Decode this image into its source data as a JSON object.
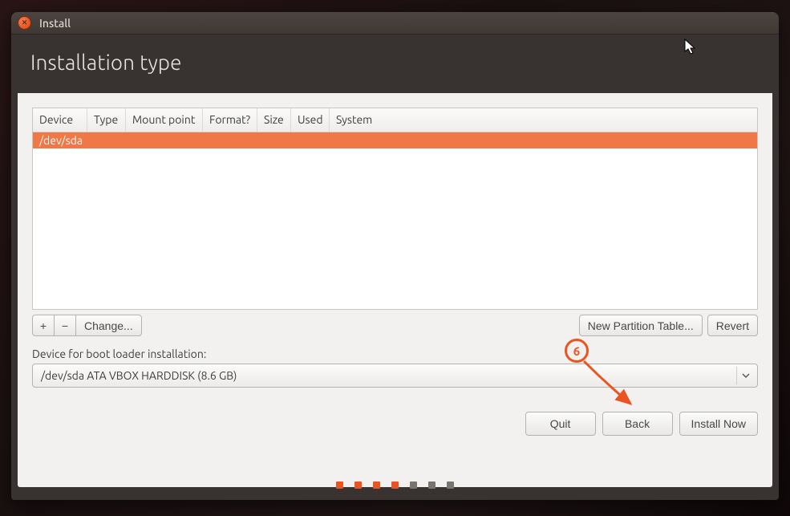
{
  "titlebar": {
    "title": "Install"
  },
  "header": {
    "page_title": "Installation type"
  },
  "table": {
    "columns": [
      "Device",
      "Type",
      "Mount point",
      "Format?",
      "Size",
      "Used",
      "System"
    ],
    "rows": [
      {
        "device": "/dev/sda"
      }
    ]
  },
  "toolbar": {
    "add_label": "+",
    "remove_label": "−",
    "change_label": "Change...",
    "new_partition_label": "New Partition Table...",
    "revert_label": "Revert"
  },
  "bootloader": {
    "label": "Device for boot loader installation:",
    "selected": "/dev/sda  ATA VBOX HARDDISK (8.6 GB)"
  },
  "footer": {
    "quit_label": "Quit",
    "back_label": "Back",
    "install_label": "Install Now"
  },
  "progress": {
    "total": 7,
    "active": [
      0,
      1,
      2,
      3
    ]
  },
  "annotation": {
    "number": "6"
  }
}
